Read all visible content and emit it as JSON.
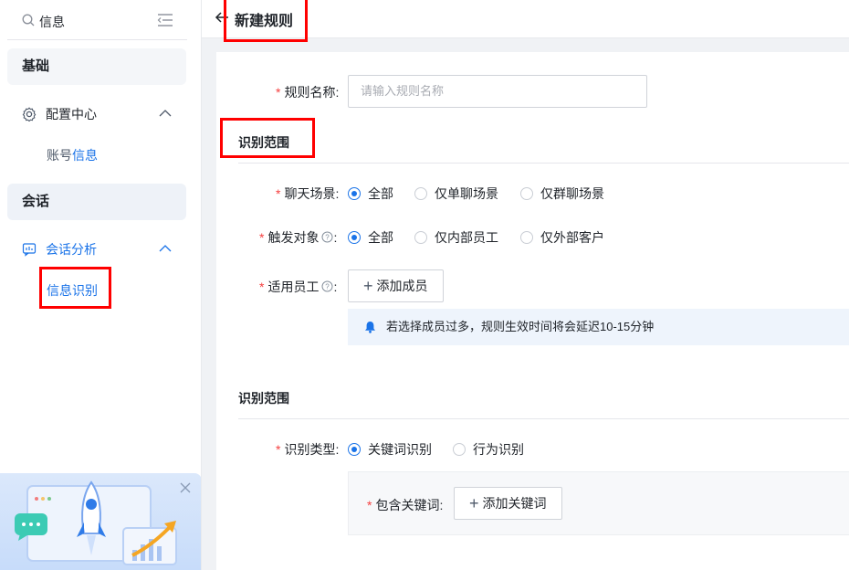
{
  "sidebar": {
    "search_text": "信息",
    "group_basic": "基础",
    "config_center": "配置中心",
    "account_prefix": "账号",
    "account_highlight": "信息",
    "group_session": "会话",
    "session_analysis": "会话分析",
    "info_recognition": "信息识别"
  },
  "header": {
    "title": "新建规则"
  },
  "form": {
    "rule_name_label": "规则名称:",
    "rule_name_placeholder": "请输入规则名称",
    "section1_title": "识别范围",
    "chat_scene_label": "聊天场景:",
    "chat_scene_options": [
      "全部",
      "仅单聊场景",
      "仅群聊场景"
    ],
    "trigger_label": "触发对象",
    "trigger_colon": ":",
    "trigger_options": [
      "全部",
      "仅内部员工",
      "仅外部客户"
    ],
    "staff_label": "适用员工",
    "add_member": "添加成员",
    "notice_text": "若选择成员过多，规则生效时间将会延迟10-15分钟",
    "section2_title": "识别范围",
    "type_label": "识别类型:",
    "type_options": [
      "关键词识别",
      "行为识别"
    ],
    "keyword_label": "包含关键词:",
    "add_keyword": "添加关键词"
  },
  "colors": {
    "accent": "#1a73e8",
    "required": "#f53f3f",
    "annotation": "#ff0000"
  }
}
